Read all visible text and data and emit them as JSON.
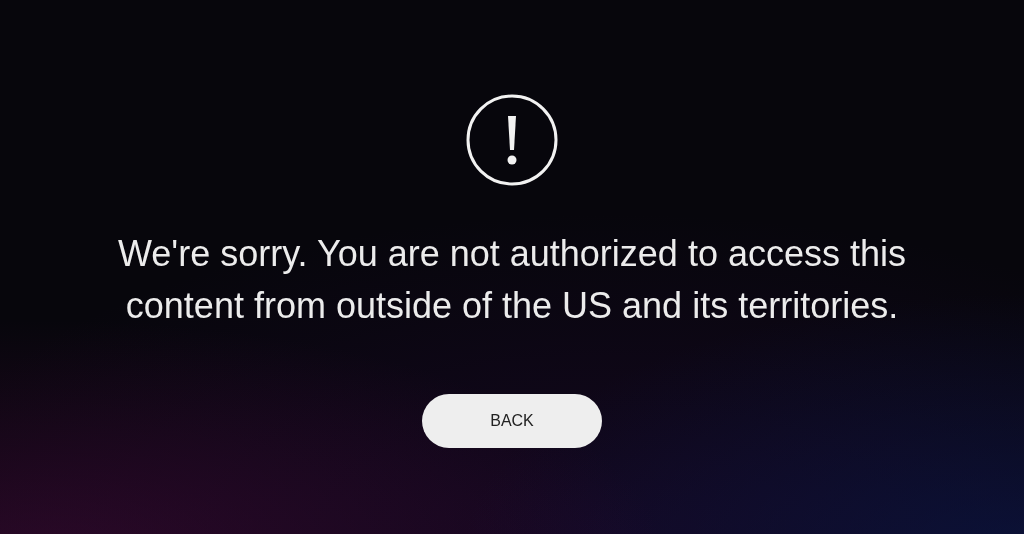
{
  "message": "We're sorry. You are not authorized to access this\ncontent from outside of the US and its territories.",
  "button": {
    "label": "BACK"
  }
}
